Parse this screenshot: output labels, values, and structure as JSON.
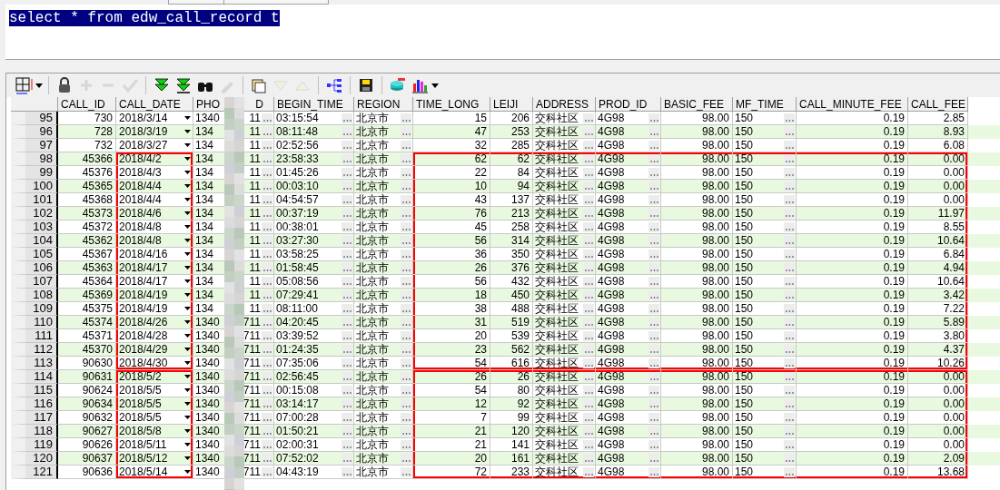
{
  "editor": {
    "selected_text": "select * from edw_call_record t"
  },
  "toolbar": [
    {
      "disabled": false
    },
    {
      "disabled": false
    },
    {
      "disabled": true
    },
    {
      "disabled": true
    },
    {
      "disabled": true
    },
    {
      "disabled": false
    },
    {
      "disabled": false
    },
    {
      "disabled": false
    },
    {
      "disabled": true
    },
    {
      "disabled": false
    },
    {
      "disabled": true
    },
    {
      "disabled": true
    },
    {
      "disabled": false
    },
    {
      "disabled": false
    },
    {
      "disabled": false
    },
    {
      "disabled": false
    }
  ],
  "columns": [
    {
      "label": "CALL_ID",
      "kind": "number",
      "outlined": false
    },
    {
      "label": "CALL_DATE",
      "kind": "date",
      "outlined": true
    },
    {
      "label": "PHO",
      "label_end": "D",
      "kind": "split",
      "outlined": false
    },
    {
      "label": "BEGIN_TIME",
      "kind": "lookup",
      "outlined": false
    },
    {
      "label": "REGION",
      "kind": "lookup",
      "outlined": false
    },
    {
      "label": "TIME_LONG",
      "kind": "number",
      "outlined": true
    },
    {
      "label": "LEIJI",
      "kind": "number",
      "outlined": true
    },
    {
      "label": "ADDRESS",
      "kind": "lookup",
      "outlined": true
    },
    {
      "label": "PROD_ID",
      "kind": "lookup",
      "outlined": true
    },
    {
      "label": "BASIC_FEE",
      "kind": "number",
      "outlined": true
    },
    {
      "label": "MF_TIME",
      "kind": "lookup",
      "outlined": true
    },
    {
      "label": "CALL_MINUTE_FEE",
      "kind": "number",
      "outlined": true
    },
    {
      "label": "CALL_FEE",
      "kind": "number",
      "outlined": true
    }
  ],
  "rows": [
    {
      "number": "95",
      "outlined": false,
      "cells": [
        "730",
        "2018/3/14",
        [
          "1340",
          "11"
        ],
        "03:15:54",
        "北京市",
        "15",
        "206",
        "交科社区",
        "4G98",
        "98.00",
        "150",
        "0.19",
        "2.85"
      ]
    },
    {
      "number": "96",
      "outlined": false,
      "cells": [
        "728",
        "2018/3/19",
        [
          "134",
          "11"
        ],
        "08:11:48",
        "北京市",
        "47",
        "253",
        "交科社区",
        "4G98",
        "98.00",
        "150",
        "0.19",
        "8.93"
      ]
    },
    {
      "number": "97",
      "outlined": false,
      "cells": [
        "732",
        "2018/3/27",
        [
          "134",
          "11"
        ],
        "02:52:56",
        "北京市",
        "32",
        "285",
        "交科社区",
        "4G98",
        "98.00",
        "150",
        "0.19",
        "6.08"
      ]
    },
    {
      "number": "98",
      "outlined": true,
      "cells": [
        "45366",
        "2018/4/2",
        [
          "134",
          "11"
        ],
        "23:58:33",
        "北京市",
        "62",
        "62",
        "交科社区",
        "4G98",
        "98.00",
        "150",
        "0.19",
        "0.00"
      ]
    },
    {
      "number": "99",
      "outlined": true,
      "cells": [
        "45376",
        "2018/4/3",
        [
          "134",
          "11"
        ],
        "01:45:26",
        "北京市",
        "22",
        "84",
        "交科社区",
        "4G98",
        "98.00",
        "150",
        "0.19",
        "0.00"
      ]
    },
    {
      "number": "100",
      "outlined": true,
      "cells": [
        "45365",
        "2018/4/4",
        [
          "134",
          "11"
        ],
        "00:03:10",
        "北京市",
        "10",
        "94",
        "交科社区",
        "4G98",
        "98.00",
        "150",
        "0.19",
        "0.00"
      ]
    },
    {
      "number": "101",
      "outlined": true,
      "cells": [
        "45368",
        "2018/4/4",
        [
          "134",
          "11"
        ],
        "04:54:57",
        "北京市",
        "43",
        "137",
        "交科社区",
        "4G98",
        "98.00",
        "150",
        "0.19",
        "0.00"
      ]
    },
    {
      "number": "102",
      "outlined": true,
      "cells": [
        "45373",
        "2018/4/6",
        [
          "134",
          "11"
        ],
        "00:37:19",
        "北京市",
        "76",
        "213",
        "交科社区",
        "4G98",
        "98.00",
        "150",
        "0.19",
        "11.97"
      ]
    },
    {
      "number": "103",
      "outlined": true,
      "cells": [
        "45372",
        "2018/4/8",
        [
          "134",
          "11"
        ],
        "00:38:01",
        "北京市",
        "45",
        "258",
        "交科社区",
        "4G98",
        "98.00",
        "150",
        "0.19",
        "8.55"
      ]
    },
    {
      "number": "104",
      "outlined": true,
      "cells": [
        "45362",
        "2018/4/8",
        [
          "134",
          "11"
        ],
        "03:27:30",
        "北京市",
        "56",
        "314",
        "交科社区",
        "4G98",
        "98.00",
        "150",
        "0.19",
        "10.64"
      ]
    },
    {
      "number": "105",
      "outlined": true,
      "cells": [
        "45367",
        "2018/4/16",
        [
          "134",
          "11"
        ],
        "03:58:25",
        "北京市",
        "36",
        "350",
        "交科社区",
        "4G98",
        "98.00",
        "150",
        "0.19",
        "6.84"
      ]
    },
    {
      "number": "106",
      "outlined": true,
      "cells": [
        "45363",
        "2018/4/17",
        [
          "134",
          "11"
        ],
        "01:58:45",
        "北京市",
        "26",
        "376",
        "交科社区",
        "4G98",
        "98.00",
        "150",
        "0.19",
        "4.94"
      ]
    },
    {
      "number": "107",
      "outlined": true,
      "cells": [
        "45364",
        "2018/4/17",
        [
          "134",
          "11"
        ],
        "05:08:56",
        "北京市",
        "56",
        "432",
        "交科社区",
        "4G98",
        "98.00",
        "150",
        "0.19",
        "10.64"
      ]
    },
    {
      "number": "108",
      "outlined": true,
      "cells": [
        "45369",
        "2018/4/19",
        [
          "134",
          "11"
        ],
        "07:29:41",
        "北京市",
        "18",
        "450",
        "交科社区",
        "4G98",
        "98.00",
        "150",
        "0.19",
        "3.42"
      ]
    },
    {
      "number": "109",
      "outlined": true,
      "cells": [
        "45375",
        "2018/4/19",
        [
          "134",
          "11"
        ],
        "08:11:00",
        "北京市",
        "38",
        "488",
        "交科社区",
        "4G98",
        "98.00",
        "150",
        "0.19",
        "7.22"
      ]
    },
    {
      "number": "110",
      "outlined": true,
      "cells": [
        "45374",
        "2018/4/26",
        [
          "1340",
          "711"
        ],
        "04:20:45",
        "北京市",
        "31",
        "519",
        "交科社区",
        "4G98",
        "98.00",
        "150",
        "0.19",
        "5.89"
      ]
    },
    {
      "number": "111",
      "outlined": true,
      "cells": [
        "45371",
        "2018/4/28",
        [
          "1340",
          "711"
        ],
        "03:39:52",
        "北京市",
        "20",
        "539",
        "交科社区",
        "4G98",
        "98.00",
        "150",
        "0.19",
        "3.80"
      ]
    },
    {
      "number": "112",
      "outlined": true,
      "cells": [
        "45370",
        "2018/4/29",
        [
          "1340",
          "711"
        ],
        "01:24:35",
        "北京市",
        "23",
        "562",
        "交科社区",
        "4G98",
        "98.00",
        "150",
        "0.19",
        "4.37"
      ]
    },
    {
      "number": "113",
      "outlined": true,
      "cells": [
        "90630",
        "2018/4/30",
        [
          "1340",
          "711"
        ],
        "07:35:06",
        "北京市",
        "54",
        "616",
        "交科社区",
        "4G98",
        "98.00",
        "150",
        "0.19",
        "10.26"
      ]
    },
    {
      "number": "114",
      "outlined": true,
      "box_start": true,
      "cells": [
        "90631",
        "2018/5/2",
        [
          "1340",
          "711"
        ],
        "02:56:45",
        "北京市",
        "26",
        "26",
        "交科社区",
        "4G98",
        "98.00",
        "150",
        "0.19",
        "0.00"
      ]
    },
    {
      "number": "115",
      "outlined": true,
      "cells": [
        "90624",
        "2018/5/5",
        [
          "1340",
          "711"
        ],
        "00:15:08",
        "北京市",
        "54",
        "80",
        "交科社区",
        "4G98",
        "98.00",
        "150",
        "0.19",
        "0.00"
      ]
    },
    {
      "number": "116",
      "outlined": true,
      "cells": [
        "90634",
        "2018/5/5",
        [
          "1340",
          "711"
        ],
        "03:14:17",
        "北京市",
        "12",
        "92",
        "交科社区",
        "4G98",
        "98.00",
        "150",
        "0.19",
        "0.00"
      ]
    },
    {
      "number": "117",
      "outlined": true,
      "cells": [
        "90632",
        "2018/5/5",
        [
          "1340",
          "711"
        ],
        "07:00:28",
        "北京市",
        "7",
        "99",
        "交科社区",
        "4G98",
        "98.00",
        "150",
        "0.19",
        "0.00"
      ]
    },
    {
      "number": "118",
      "outlined": true,
      "cells": [
        "90627",
        "2018/5/8",
        [
          "1340",
          "711"
        ],
        "01:50:21",
        "北京市",
        "21",
        "120",
        "交科社区",
        "4G98",
        "98.00",
        "150",
        "0.19",
        "0.00"
      ]
    },
    {
      "number": "119",
      "outlined": true,
      "cells": [
        "90626",
        "2018/5/11",
        [
          "1340",
          "711"
        ],
        "02:00:31",
        "北京市",
        "21",
        "141",
        "交科社区",
        "4G98",
        "98.00",
        "150",
        "0.19",
        "0.00"
      ]
    },
    {
      "number": "120",
      "outlined": true,
      "cells": [
        "90637",
        "2018/5/12",
        [
          "1340",
          "711"
        ],
        "07:52:02",
        "北京市",
        "20",
        "161",
        "交科社区",
        "4G98",
        "98.00",
        "150",
        "0.19",
        "2.09"
      ]
    },
    {
      "number": "121",
      "outlined": true,
      "cells": [
        "90636",
        "2018/5/14",
        [
          "1340",
          "711"
        ],
        "04:43:19",
        "北京市",
        "72",
        "233",
        "交科社区",
        "4G98",
        "98.00",
        "150",
        "0.19",
        "13.68"
      ]
    }
  ]
}
